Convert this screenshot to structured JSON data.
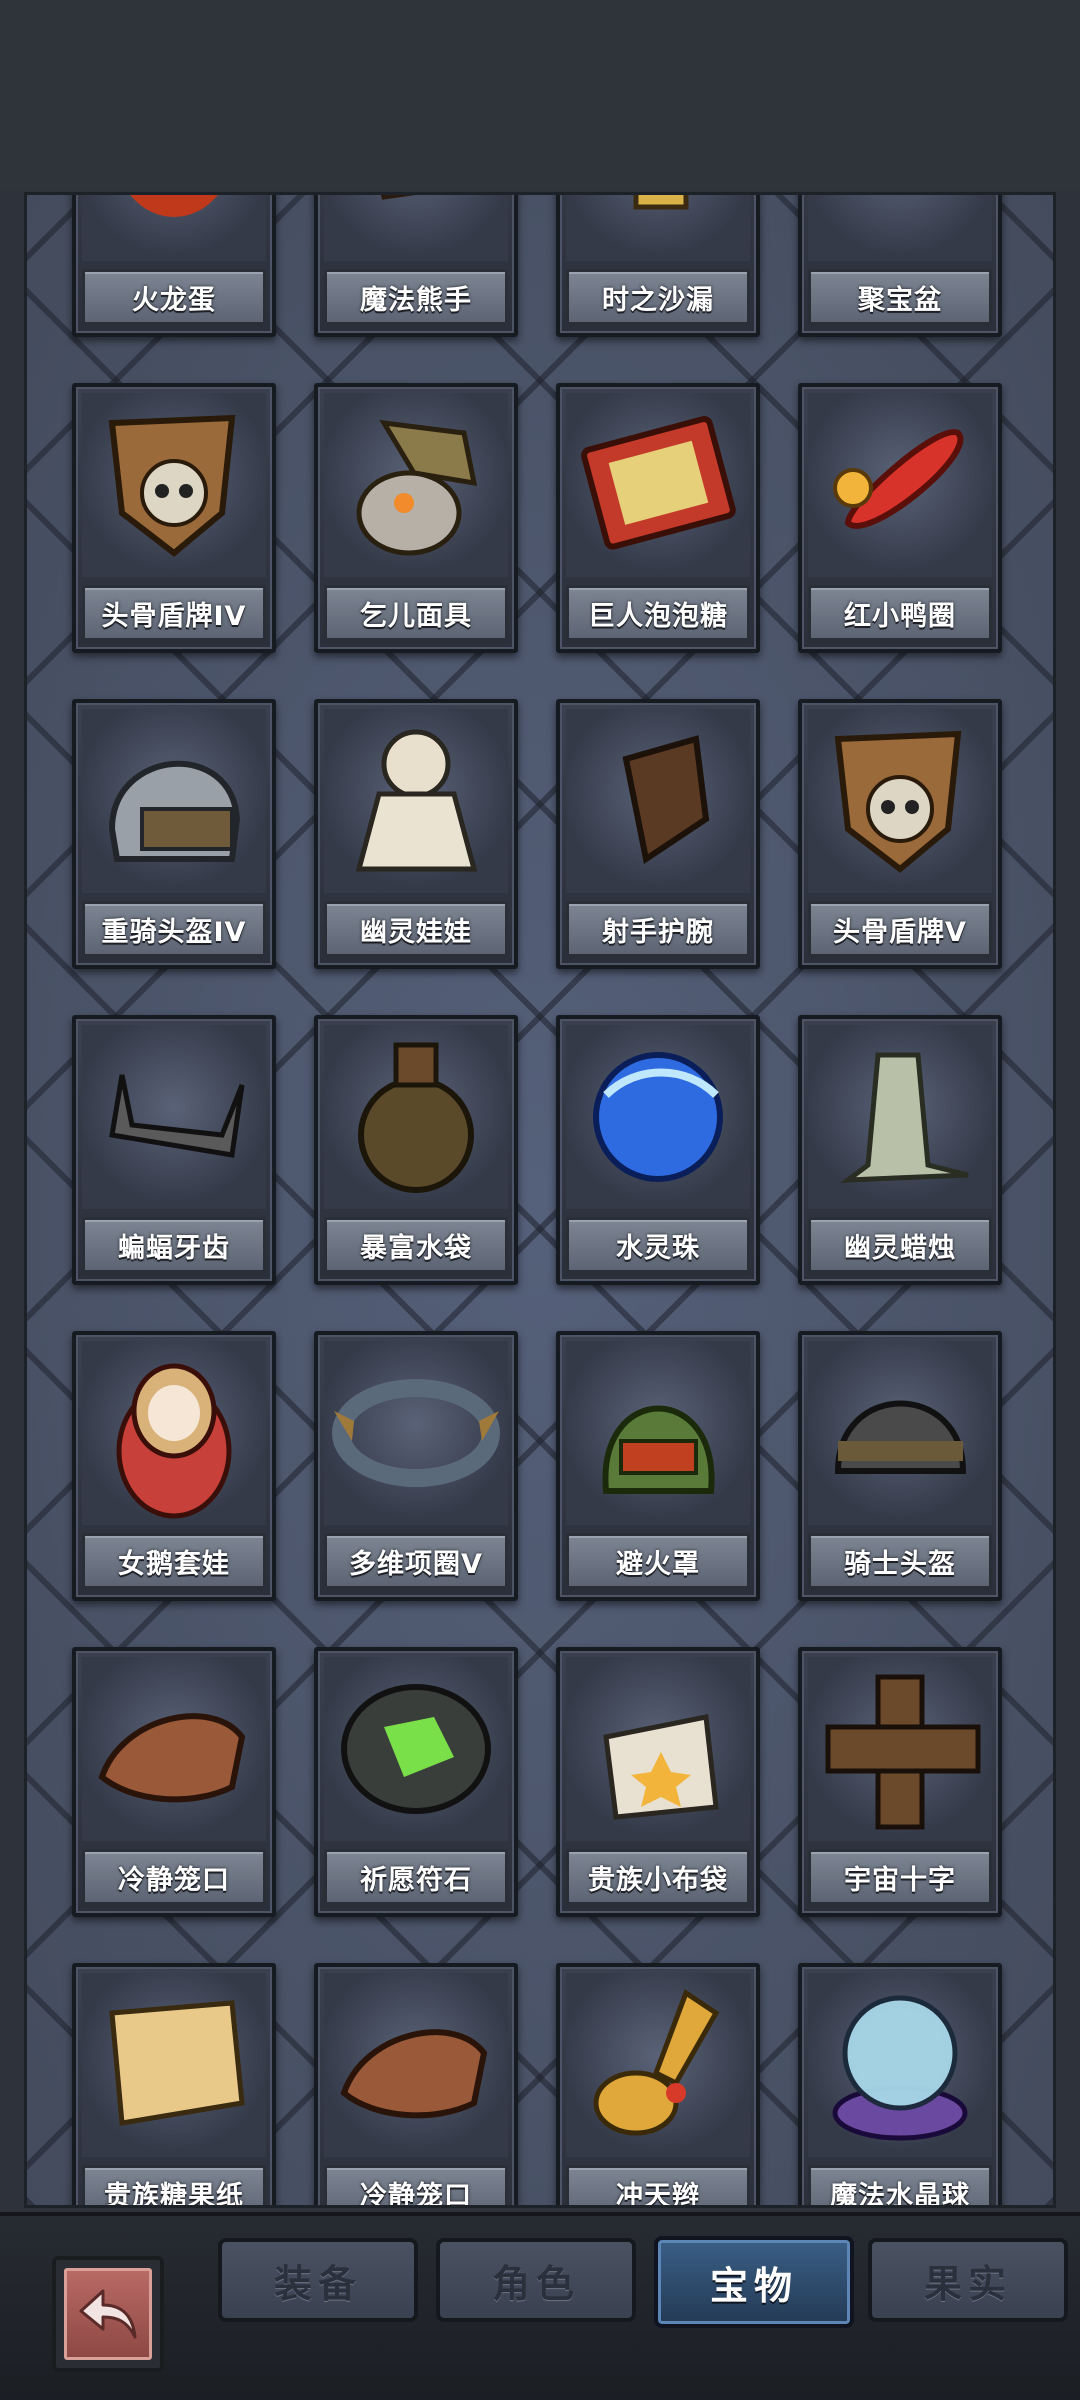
{
  "tabs": [
    {
      "label": "装备",
      "active": false
    },
    {
      "label": "角色",
      "active": false
    },
    {
      "label": "宝物",
      "active": true
    },
    {
      "label": "果实",
      "active": false
    }
  ],
  "items": [
    {
      "name": "火龙蛋",
      "icon": "fire-dragon-egg-icon"
    },
    {
      "name": "魔法熊手",
      "icon": "magic-bear-paw-icon"
    },
    {
      "name": "时之沙漏",
      "icon": "hourglass-icon"
    },
    {
      "name": "聚宝盆",
      "icon": "treasure-bowl-icon"
    },
    {
      "name": "头骨盾牌IV",
      "icon": "skull-shield-icon"
    },
    {
      "name": "乞儿面具",
      "icon": "beggar-mask-icon"
    },
    {
      "name": "巨人泡泡糖",
      "icon": "bubblegum-box-icon"
    },
    {
      "name": "红小鸭圈",
      "icon": "duck-ring-icon"
    },
    {
      "name": "重骑头盔IV",
      "icon": "heavy-helmet-icon"
    },
    {
      "name": "幽灵娃娃",
      "icon": "ghost-doll-icon"
    },
    {
      "name": "射手护腕",
      "icon": "archer-bracer-icon"
    },
    {
      "name": "头骨盾牌V",
      "icon": "skull-shield-icon"
    },
    {
      "name": "蝙蝠牙齿",
      "icon": "bat-teeth-icon"
    },
    {
      "name": "暴富水袋",
      "icon": "water-pouch-icon"
    },
    {
      "name": "水灵珠",
      "icon": "water-orb-icon"
    },
    {
      "name": "幽灵蜡烛",
      "icon": "ghost-candle-icon"
    },
    {
      "name": "女鹅套娃",
      "icon": "nesting-doll-icon"
    },
    {
      "name": "多维项圈V",
      "icon": "spiked-collar-icon"
    },
    {
      "name": "避火罩",
      "icon": "fire-hood-icon"
    },
    {
      "name": "骑士头盔",
      "icon": "knight-helmet-icon"
    },
    {
      "name": "冷静笼口",
      "icon": "muzzle-icon"
    },
    {
      "name": "祈愿符石",
      "icon": "wish-rune-stone-icon"
    },
    {
      "name": "贵族小布袋",
      "icon": "noble-sack-icon"
    },
    {
      "name": "宇宙十字",
      "icon": "cosmic-cross-icon"
    },
    {
      "name": "贵族糖果纸",
      "icon": "candy-paper-icon"
    },
    {
      "name": "冷静笼口",
      "icon": "muzzle-icon"
    },
    {
      "name": "冲天辫",
      "icon": "pigtail-icon"
    },
    {
      "name": "魔法水晶球",
      "icon": "crystal-ball-icon"
    }
  ],
  "colors": {
    "panel": "#454d5e",
    "tab_active": "#3a5f86",
    "back_button": "#b86a65"
  }
}
